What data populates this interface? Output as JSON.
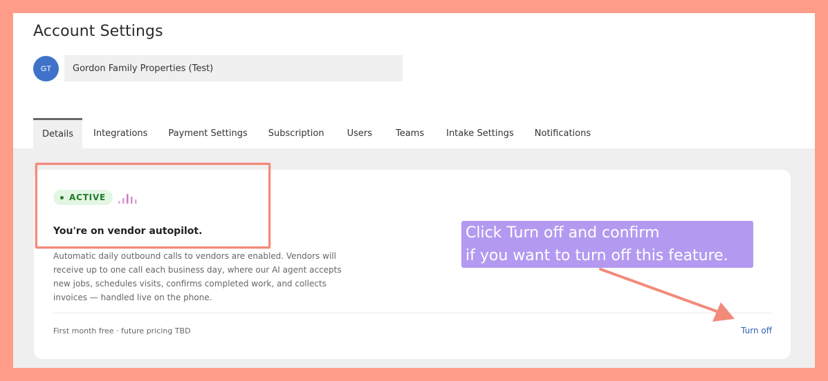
{
  "page": {
    "title": "Account Settings"
  },
  "account": {
    "initials": "GT",
    "name": "Gordon Family Properties (Test)"
  },
  "tabs": [
    {
      "label": "Details",
      "active": true
    },
    {
      "label": "Integrations",
      "active": false
    },
    {
      "label": "Payment Settings",
      "active": false
    },
    {
      "label": "Subscription",
      "active": false
    },
    {
      "label": "Users",
      "active": false
    },
    {
      "label": "Teams",
      "active": false
    },
    {
      "label": "Intake Settings",
      "active": false
    },
    {
      "label": "Notifications",
      "active": false
    }
  ],
  "card": {
    "status": "ACTIVE",
    "heading": "You're on vendor autopilot.",
    "description": "Automatic daily outbound calls to vendors are enabled. Vendors will receive up to one call each business day, where our AI agent accepts new jobs, schedules visits, confirms completed work, and collects invoices — handled live on the phone.",
    "footer_note": "First month free · future pricing TBD",
    "turn_off_label": "Turn off"
  },
  "annotation": {
    "callout_line1": "Click Turn off and confirm",
    "callout_line2": "if you want to turn off this feature."
  },
  "colors": {
    "background": "#ff9d8a",
    "accent_link": "#2f63b5",
    "active_badge_bg": "#e3f6e3",
    "active_badge_text": "#1f7a2a",
    "callout_bg": "#b39af0",
    "highlight": "#f28a7a",
    "bars_icon": "#d07ac4"
  }
}
